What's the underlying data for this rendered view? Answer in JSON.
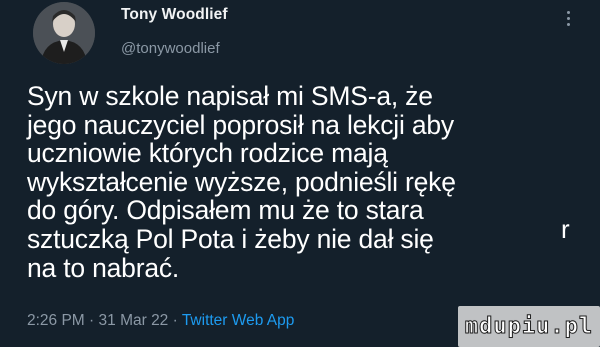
{
  "tweet": {
    "display_name": "Tony Woodlief",
    "handle": "@tonywoodlief",
    "avatar_icon": "avatar-photo",
    "more_icon": "vertical-ellipsis-icon",
    "text": "Syn w szkole napisał mi SMS-a, że\njego nauczyciel poprosił na lekcji aby\nuczniowie których rodzice mają\nwykształcenie wyższe, podnieśli rękę\ndo góry. Odpisałem mu że to stara\nsztuczką Pol Pota i żeby nie dał się\nna to nabrać.",
    "stray_char": "r",
    "time": "2:26 PM",
    "separator": " · ",
    "date": "31 Mar 22",
    "source": "Twitter Web App"
  },
  "watermark": {
    "text": "mdupiu.pl"
  },
  "colors": {
    "background": "#14202b",
    "text": "#ffffff",
    "secondary": "#8b98a5",
    "link": "#1d9bf0"
  }
}
